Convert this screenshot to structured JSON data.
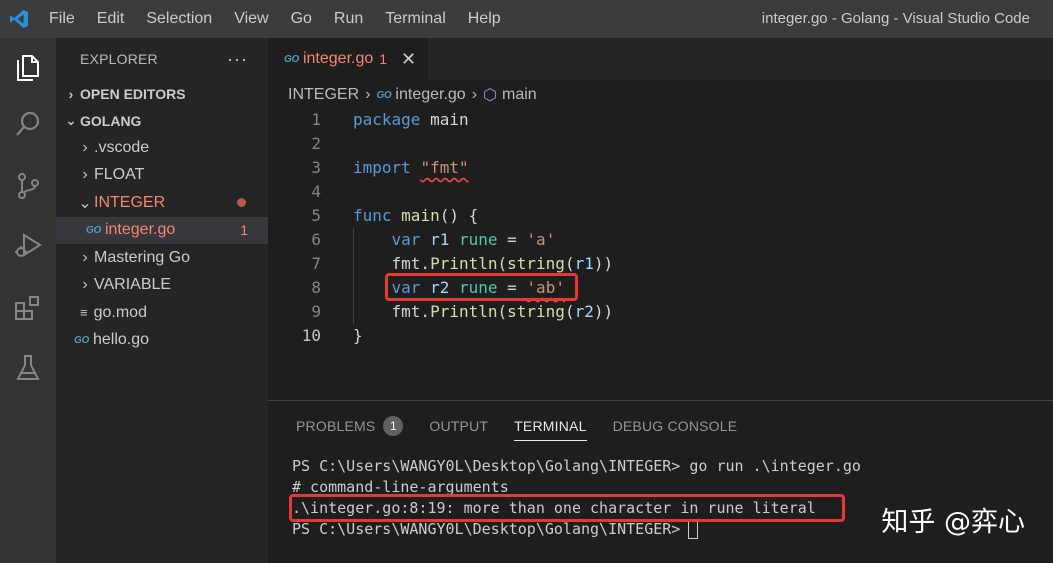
{
  "titlebar": {
    "menu": [
      "File",
      "Edit",
      "Selection",
      "View",
      "Go",
      "Run",
      "Terminal",
      "Help"
    ],
    "window_title": "integer.go - Golang - Visual Studio Code"
  },
  "sidebar": {
    "header": "EXPLORER",
    "more": "···",
    "open_editors": "OPEN EDITORS",
    "workspace": "GOLANG",
    "items": [
      {
        "label": ".vscode",
        "type": "folder"
      },
      {
        "label": "FLOAT",
        "type": "folder"
      },
      {
        "label": "INTEGER",
        "type": "folder-open"
      },
      {
        "label": "integer.go",
        "type": "go-file",
        "badge": "1"
      },
      {
        "label": "Mastering Go",
        "type": "folder"
      },
      {
        "label": "VARIABLE",
        "type": "folder"
      },
      {
        "label": "go.mod",
        "type": "file"
      },
      {
        "label": "hello.go",
        "type": "go-file"
      }
    ]
  },
  "tab": {
    "label": "integer.go",
    "problems": "1",
    "close": "✕"
  },
  "breadcrumb": {
    "folder": "INTEGER",
    "file": "integer.go",
    "symbol": "main"
  },
  "editor": {
    "line_numbers": [
      "1",
      "2",
      "3",
      "4",
      "5",
      "6",
      "7",
      "8",
      "9",
      "10"
    ],
    "code": {
      "l1_kw": "package",
      "l1_rest": " main",
      "l3_kw": "import",
      "l3_str": "\"fmt\"",
      "l5_kw": "func",
      "l5_fn": "main",
      "l5_rest": "() {",
      "l6_kw": "var",
      "l6_var": "r1",
      "l6_ty": "rune",
      "l6_str": "'a'",
      "l7_pkg": "fmt.",
      "l7_fn": "Println",
      "l7_conv": "string",
      "l7_arg": "r1",
      "l8_kw": "var",
      "l8_var": "r2",
      "l8_ty": "rune",
      "l8_str": "'ab'",
      "l9_pkg": "fmt.",
      "l9_fn": "Println",
      "l9_conv": "string",
      "l9_arg": "r2",
      "l10": "}"
    }
  },
  "panel": {
    "tabs": [
      "PROBLEMS",
      "OUTPUT",
      "TERMINAL",
      "DEBUG CONSOLE"
    ],
    "problems_count": "1",
    "terminal": [
      "PS C:\\Users\\WANGY0L\\Desktop\\Golang\\INTEGER> go run .\\integer.go",
      "# command-line-arguments",
      ".\\integer.go:8:19: more than one character in rune literal",
      "PS C:\\Users\\WANGY0L\\Desktop\\Golang\\INTEGER>"
    ]
  },
  "watermark": "知乎 @弈心",
  "colors": {
    "accent": "#007acc",
    "error": "#f48771",
    "highlight_box": "#e53935"
  }
}
